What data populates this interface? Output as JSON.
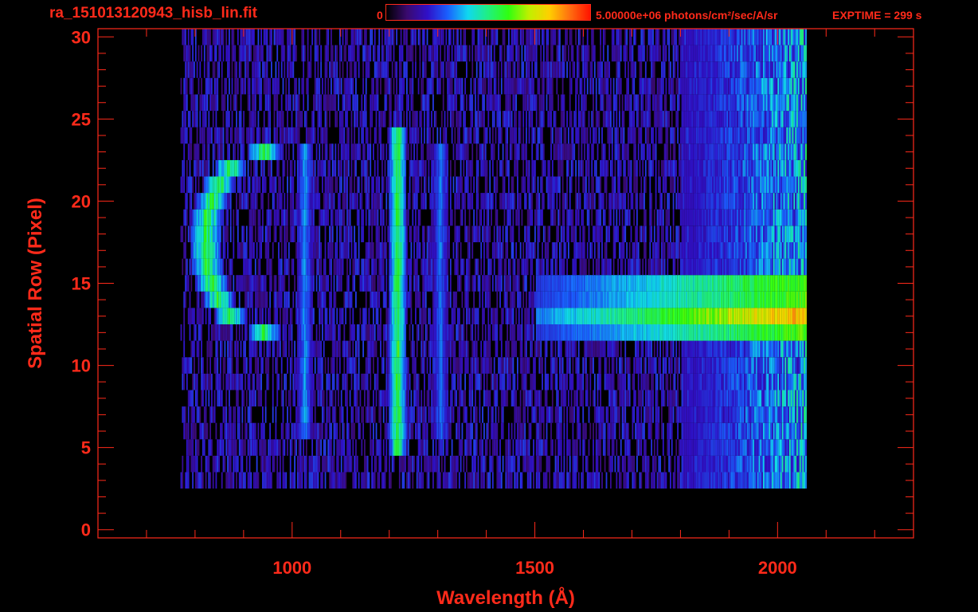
{
  "header": {
    "file_title": "ra_151013120943_hisb_lin.fit",
    "colorbar_min_label": "0",
    "colorbar_max_label": "5.00000e+06 photons/cm²/sec/A/sr",
    "exptime_label": "EXPTIME = 299 s"
  },
  "colors": {
    "axis": "#ff2a1a",
    "background": "#000000",
    "colormap": [
      "#000000",
      "#3a0a6e",
      "#3010c8",
      "#1a60ff",
      "#10d8f0",
      "#20f080",
      "#30ff10",
      "#c0f000",
      "#ffd000",
      "#ff7010",
      "#ff1500"
    ]
  },
  "chart_data": {
    "type": "heatmap",
    "title": "",
    "xlabel": "Wavelength (Å)",
    "ylabel": "Spatial Row (Pixel)",
    "xlim": [
      600,
      2280
    ],
    "ylim": [
      -0.5,
      30.5
    ],
    "x_ticks": [
      1000,
      1500,
      2000
    ],
    "y_ticks": [
      0,
      5,
      10,
      15,
      20,
      25,
      30
    ],
    "x_tick_labels": [
      "1000",
      "1500",
      "2000"
    ],
    "y_tick_labels": [
      "0",
      "5",
      "10",
      "15",
      "20",
      "25",
      "30"
    ],
    "x_data_range": [
      770,
      2060
    ],
    "y_data_range": [
      3,
      30
    ],
    "value_range": [
      0,
      5000000
    ],
    "value_unit": "photons/cm²/sec/A/sr",
    "features": [
      {
        "name": "emission arc (C-shape)",
        "x_center": 820,
        "y_range": [
          12,
          23
        ],
        "peak_value": 3300000
      },
      {
        "name": "line",
        "x": 1025,
        "y_range": [
          6,
          23
        ],
        "peak_value": 2000000
      },
      {
        "name": "bright line",
        "x": 1216,
        "y_range": [
          5,
          24
        ],
        "peak_value": 3300000
      },
      {
        "name": "line",
        "x": 1304,
        "y_range": [
          6,
          23
        ],
        "peak_value": 1800000
      },
      {
        "name": "bright band",
        "x_range": [
          1500,
          2060
        ],
        "y_range": [
          12,
          15
        ],
        "peak_value": 4500000
      },
      {
        "name": "continuum",
        "x_range": [
          1800,
          2060
        ],
        "y_range": [
          3,
          30
        ],
        "peak_value": 2800000
      }
    ],
    "grid": false,
    "colorbar": true
  }
}
